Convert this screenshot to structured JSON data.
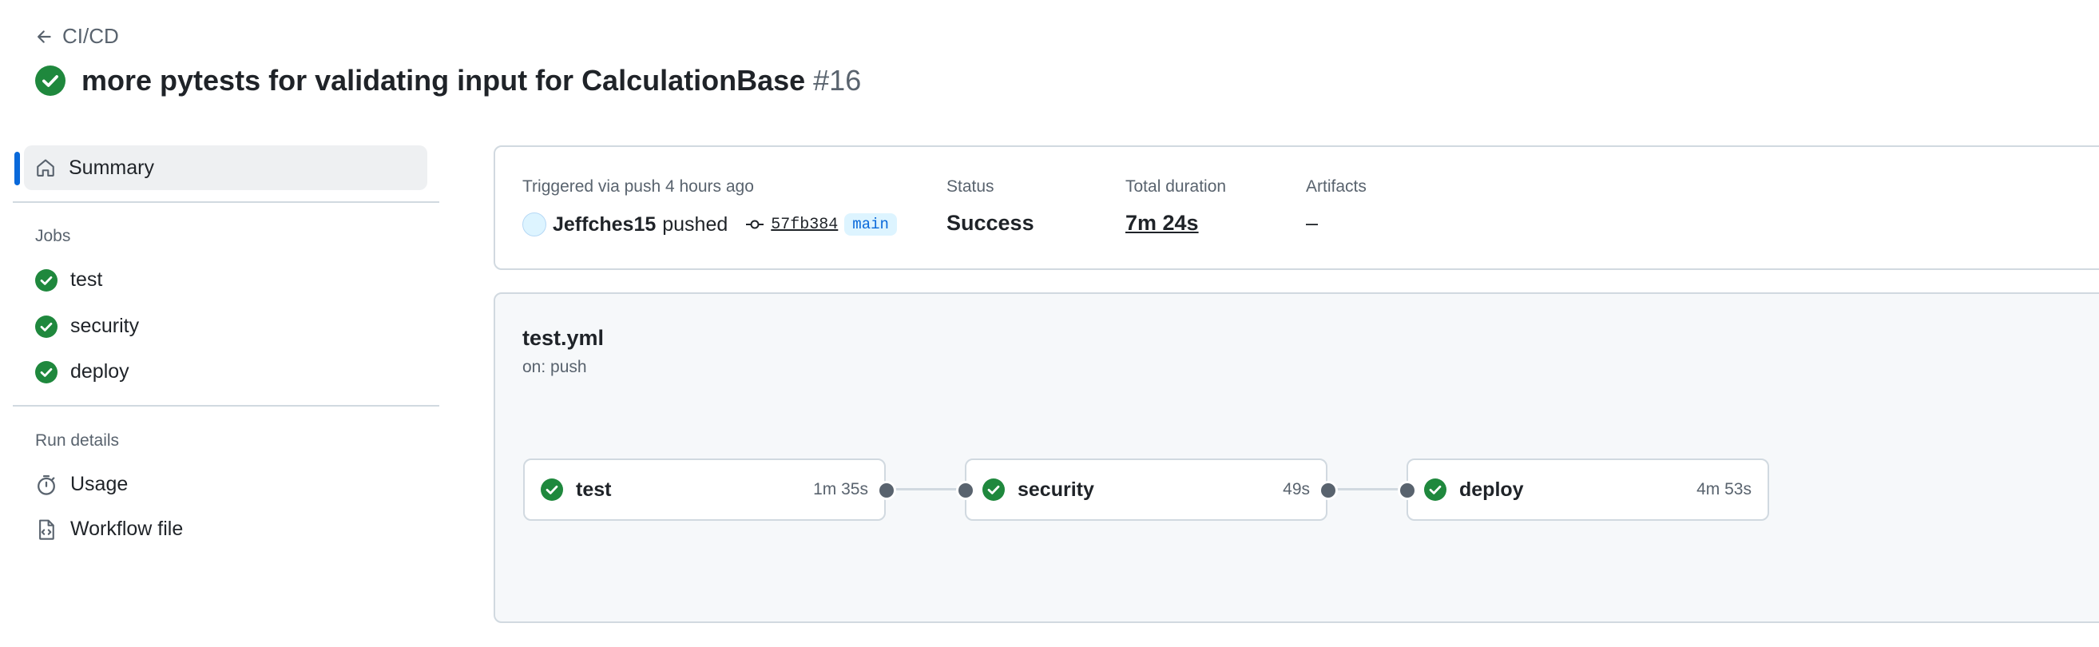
{
  "header": {
    "back_label": "CI/CD",
    "title": "more pytests for validating input for CalculationBase",
    "run_number": "#16"
  },
  "sidebar": {
    "summary_label": "Summary",
    "jobs_heading": "Jobs",
    "jobs": [
      {
        "label": "test"
      },
      {
        "label": "security"
      },
      {
        "label": "deploy"
      }
    ],
    "run_details_heading": "Run details",
    "usage_label": "Usage",
    "workflow_file_label": "Workflow file"
  },
  "summary": {
    "trigger_text": "Triggered via push 4 hours ago",
    "actor": "Jeffches15",
    "action": "pushed",
    "commit_sha": "57fb384",
    "branch": "main",
    "status_label": "Status",
    "status_value": "Success",
    "duration_label": "Total duration",
    "duration_value": "7m 24s",
    "artifacts_label": "Artifacts",
    "artifacts_value": "–"
  },
  "workflow": {
    "file": "test.yml",
    "trigger": "on: push",
    "jobs": [
      {
        "name": "test",
        "duration": "1m 35s"
      },
      {
        "name": "security",
        "duration": "49s"
      },
      {
        "name": "deploy",
        "duration": "4m 53s"
      }
    ]
  },
  "colors": {
    "success": "#1f883d",
    "accent": "#0969da",
    "border": "#d1d9e0",
    "muted": "#59636e"
  }
}
